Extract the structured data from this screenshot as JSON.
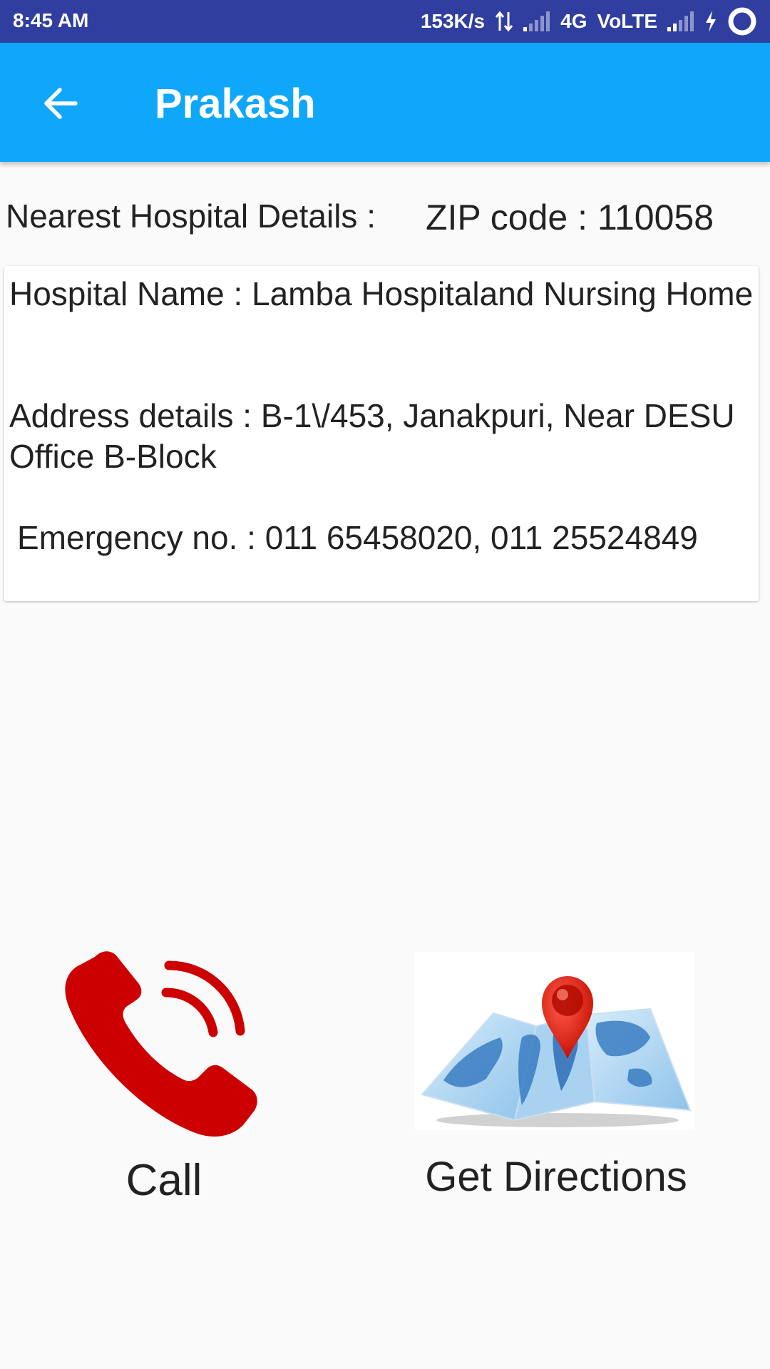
{
  "status_bar": {
    "time": "8:45 AM",
    "net_speed": "153K/s",
    "network": "4G",
    "volte": "VoLTE"
  },
  "app_bar": {
    "title": "Prakash",
    "back_icon": "arrow-left-icon"
  },
  "section": {
    "label": "Nearest Hospital Details :",
    "zip": "ZIP code : 110058"
  },
  "hospital": {
    "name": "Hospital Name : Lamba Hospitaland Nursing Home",
    "address": "Address details : B-1\\/453, Janakpuri, Near DESU Office B-Block",
    "emergency": "Emergency no. : 011 65458020, 011 25524849"
  },
  "actions": {
    "call_label": "Call",
    "call_icon": "phone-icon",
    "directions_label": "Get Directions",
    "directions_icon": "map-pin-icon"
  },
  "colors": {
    "status_bar": "#303f9f",
    "app_bar": "#0fa7f9",
    "call_icon": "#cc0000",
    "pin": "#e01a0f"
  }
}
